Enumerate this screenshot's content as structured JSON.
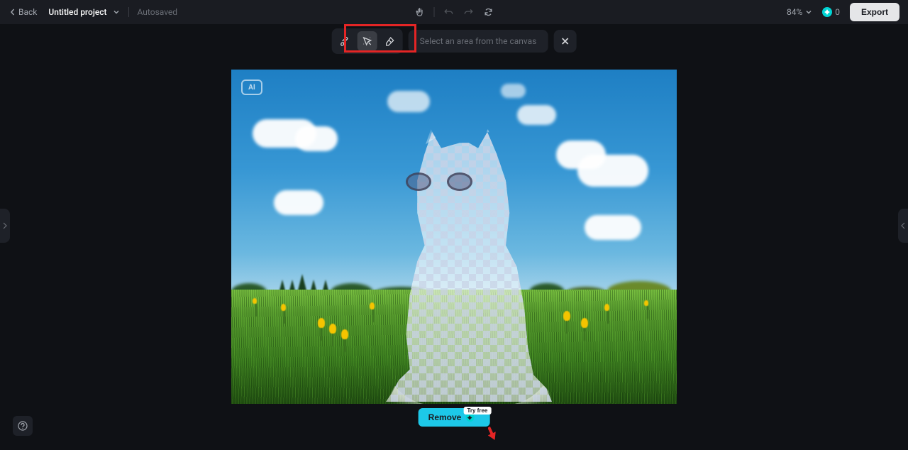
{
  "header": {
    "back_label": "Back",
    "project_title": "Untitled project",
    "autosaved_label": "Autosaved",
    "zoom": "84%",
    "credits": "0",
    "export_label": "Export"
  },
  "toolbar": {
    "hint": "Select an area from the canvas",
    "tools": [
      "brush",
      "auto-select",
      "eraser"
    ],
    "active_tool": "auto-select"
  },
  "canvas": {
    "ai_badge": "AI"
  },
  "action": {
    "remove_label": "Remove",
    "try_free_label": "Try free"
  },
  "icons": {
    "hand": "hand-icon",
    "undo": "undo-icon",
    "redo": "redo-icon",
    "refresh": "refresh-icon"
  }
}
